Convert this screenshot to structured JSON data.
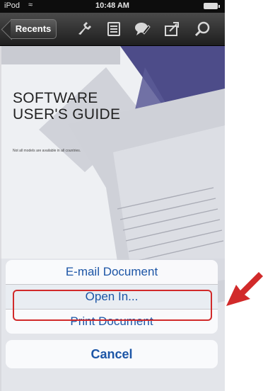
{
  "status_bar": {
    "carrier": "iPod",
    "time": "10:48 AM"
  },
  "toolbar": {
    "back_label": "Recents",
    "icons": [
      "tools-icon",
      "reader-mode-icon",
      "annotate-icon",
      "share-icon",
      "search-icon"
    ]
  },
  "document": {
    "title_line1": "SOFTWARE",
    "title_line2": "USER'S GUIDE",
    "subtitle": "Not all models are available in all countries."
  },
  "action_sheet": {
    "items": [
      "E-mail Document",
      "Open In...",
      "Print Document"
    ],
    "cancel_label": "Cancel",
    "highlighted_index": 1
  },
  "colors": {
    "action_text": "#1c55a6",
    "callout": "#d12a2a",
    "doc_shape": "#4a4a8a"
  }
}
